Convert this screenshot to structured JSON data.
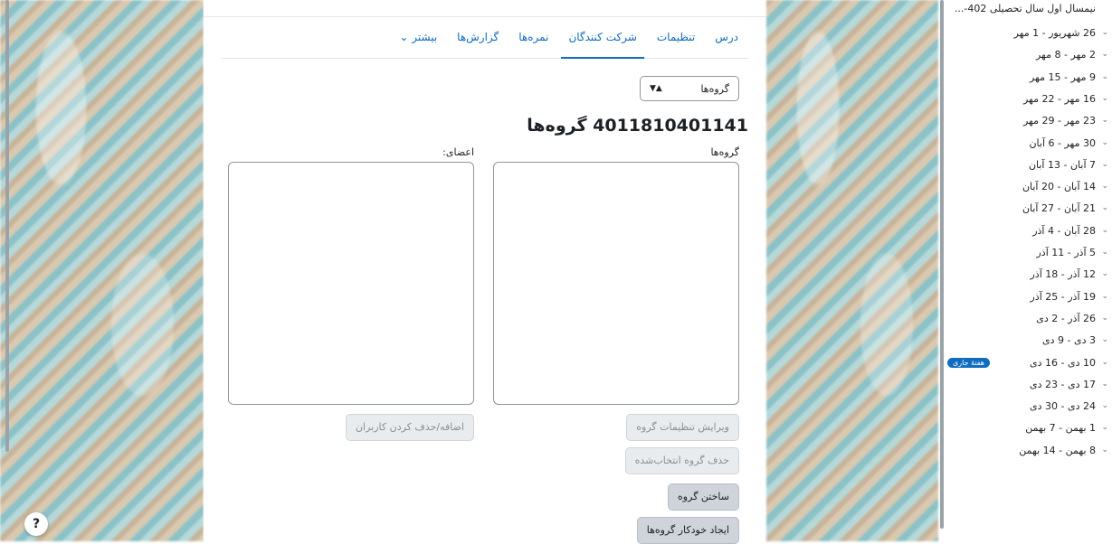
{
  "tabs": [
    {
      "label": "درس",
      "active": false
    },
    {
      "label": "تنظیمات",
      "active": false
    },
    {
      "label": "شرکت کنندگان",
      "active": true
    },
    {
      "label": "نمره‌ها",
      "active": false
    },
    {
      "label": "گزارش‌ها",
      "active": false
    },
    {
      "label": "بیشتر ⌄",
      "active": false
    }
  ],
  "group_select": {
    "value": "گروه‌ها"
  },
  "page_title": "4011810401141 گروه‌ها",
  "groups_label": "گروه‌ها",
  "members_label": "اعضای:",
  "buttons": {
    "edit_group": "ویرایش تنظیمات گروه",
    "delete_group": "حذف گروه انتخاب‌شده",
    "create_group": "ساختن گروه",
    "auto_create": "ایجاد خودکار گروه‌ها",
    "add_remove_users": "اضافه/حذف کردن کاربران"
  },
  "help_label": "?",
  "sidebar": {
    "header": "نیمسال اول سال تحصیلی 402-...",
    "current_week_badge": "هفتهٔ جاری",
    "items": [
      "26 شهریور - 1 مهر",
      "2 مهر - 8 مهر",
      "9 مهر - 15 مهر",
      "16 مهر - 22 مهر",
      "23 مهر - 29 مهر",
      "30 مهر - 6 آبان",
      "7 آبان - 13 آبان",
      "14 آبان - 20 آبان",
      "21 آبان - 27 آبان",
      "28 آبان - 4 آذر",
      "5 آذر - 11 آذر",
      "12 آذر - 18 آذر",
      "19 آذر - 25 آذر",
      "26 آذر - 2 دی",
      "3 دی - 9 دی",
      "10 دی - 16 دی",
      "17 دی - 23 دی",
      "24 دی - 30 دی",
      "1 بهمن - 7 بهمن",
      "8 بهمن - 14 بهمن"
    ]
  },
  "colors": {
    "accent": "#0f6cbf"
  }
}
